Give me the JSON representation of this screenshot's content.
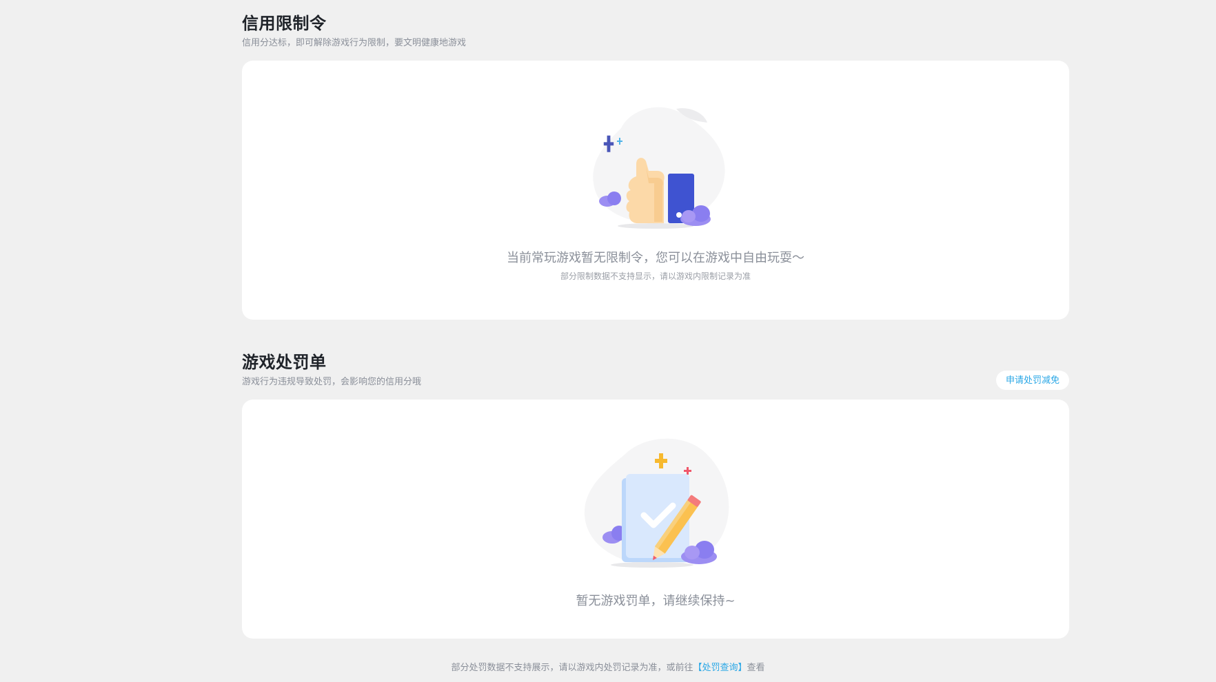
{
  "credit_restriction": {
    "title": "信用限制令",
    "subtitle": "信用分达标，即可解除游戏行为限制，要文明健康地游戏",
    "empty_main": "当前常玩游戏暂无限制令，您可以在游戏中自由玩耍～",
    "empty_sub": "部分限制数据不支持显示，请以游戏内限制记录为准",
    "illustration_icon": "thumbs-up-icon"
  },
  "penalty": {
    "title": "游戏处罚单",
    "subtitle": "游戏行为违规导致处罚，会影响您的信用分哦",
    "apply_button": "申请处罚减免",
    "empty_main": "暂无游戏罚单，请继续保持~",
    "illustration_icon": "checklist-pencil-icon"
  },
  "footer": {
    "note_prefix": "部分处罚数据不支持展示，请以游戏内处罚记录为准，或前往",
    "link": "【处罚查询】",
    "note_suffix": "查看"
  },
  "colors": {
    "background": "#f0f0f0",
    "card": "#ffffff",
    "accent": "#2aa7e6",
    "title": "#1f2329",
    "muted": "#8a8f99"
  }
}
